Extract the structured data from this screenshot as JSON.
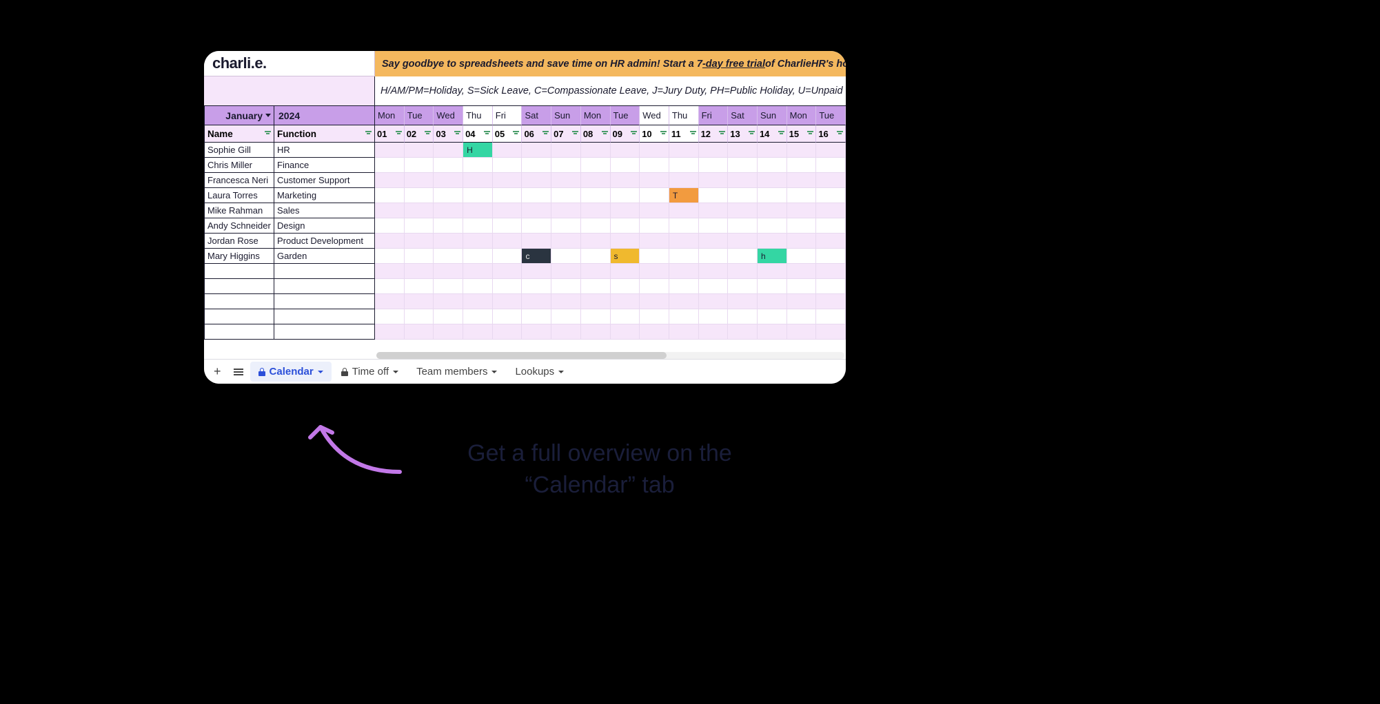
{
  "logo": "charli.e.",
  "banner": {
    "prefix": "Say goodbye to spreadsheets and save time on HR admin! Start a 7",
    "underline": "-day free trial",
    "suffix": " of CharlieHR's holiday tra"
  },
  "legend": "H/AM/PM=Holiday, S=Sick Leave, C=Compassionate Leave, J=Jury Duty, PH=Public Holiday, U=Unpaid Leave, T",
  "month": "January",
  "year": "2024",
  "columns": {
    "name": "Name",
    "function": "Function"
  },
  "days": [
    {
      "dow": "Mon",
      "num": "01",
      "white": false
    },
    {
      "dow": "Tue",
      "num": "02",
      "white": false
    },
    {
      "dow": "Wed",
      "num": "03",
      "white": false
    },
    {
      "dow": "Thu",
      "num": "04",
      "white": true
    },
    {
      "dow": "Fri",
      "num": "05",
      "white": true
    },
    {
      "dow": "Sat",
      "num": "06",
      "white": false
    },
    {
      "dow": "Sun",
      "num": "07",
      "white": false
    },
    {
      "dow": "Mon",
      "num": "08",
      "white": false
    },
    {
      "dow": "Tue",
      "num": "09",
      "white": false
    },
    {
      "dow": "Wed",
      "num": "10",
      "white": true
    },
    {
      "dow": "Thu",
      "num": "11",
      "white": true
    },
    {
      "dow": "Fri",
      "num": "12",
      "white": false
    },
    {
      "dow": "Sat",
      "num": "13",
      "white": false
    },
    {
      "dow": "Sun",
      "num": "14",
      "white": false
    },
    {
      "dow": "Mon",
      "num": "15",
      "white": false
    },
    {
      "dow": "Tue",
      "num": "16",
      "white": false
    }
  ],
  "rows": [
    {
      "name": "Sophie Gill",
      "function": "HR",
      "events": {
        "3": {
          "code": "H",
          "cls": "ev-H"
        }
      }
    },
    {
      "name": "Chris Miller",
      "function": "Finance",
      "events": {}
    },
    {
      "name": "Francesca Neri",
      "function": "Customer Support",
      "events": {}
    },
    {
      "name": "Laura Torres",
      "function": "Marketing",
      "events": {
        "10": {
          "code": "T",
          "cls": "ev-T"
        }
      }
    },
    {
      "name": "Mike Rahman",
      "function": "Sales",
      "events": {}
    },
    {
      "name": "Andy Schneider",
      "function": "Design",
      "events": {}
    },
    {
      "name": "Jordan Rose",
      "function": "Product Development",
      "events": {}
    },
    {
      "name": "Mary Higgins",
      "function": "Garden",
      "events": {
        "5": {
          "code": "c",
          "cls": "ev-c"
        },
        "8": {
          "code": "s",
          "cls": "ev-s"
        },
        "13": {
          "code": "h",
          "cls": "ev-h"
        }
      }
    },
    {
      "name": "",
      "function": "",
      "events": {}
    },
    {
      "name": "",
      "function": "",
      "events": {}
    },
    {
      "name": "",
      "function": "",
      "events": {}
    },
    {
      "name": "",
      "function": "",
      "events": {}
    },
    {
      "name": "",
      "function": "",
      "events": {}
    }
  ],
  "tabs": {
    "calendar": "Calendar",
    "timeoff": "Time off",
    "team": "Team members",
    "lookups": "Lookups"
  },
  "caption": "Get a full overview on the “Calendar” tab"
}
